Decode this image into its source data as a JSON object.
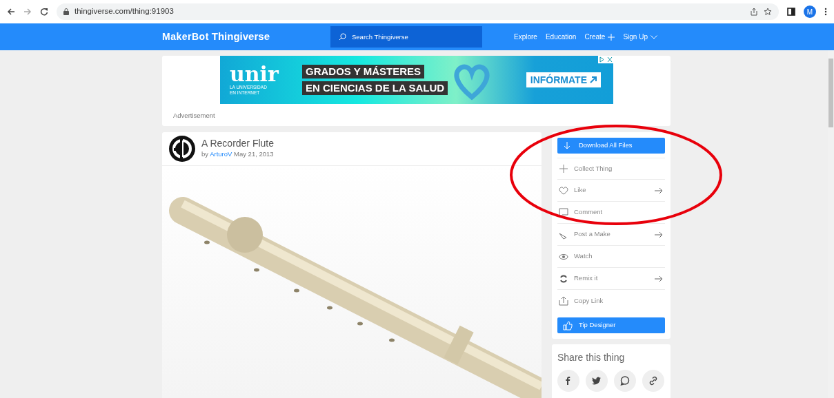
{
  "browser": {
    "url": "thingiverse.com/thing:91903",
    "profile_initial": "M"
  },
  "navbar": {
    "logo_brand": "MakerBot",
    "logo_name": "Thingiverse",
    "search_placeholder": "Search Thingiverse",
    "links": [
      {
        "label": "Explore",
        "kind": "plain"
      },
      {
        "label": "Education",
        "kind": "plain"
      },
      {
        "label": "Create",
        "kind": "plus"
      },
      {
        "label": "Sign Up",
        "kind": "dropdown"
      }
    ]
  },
  "ad": {
    "brand": "unir",
    "brand_lines": [
      "LA UNIVERSIDAD",
      "EN INTERNET"
    ],
    "headline": [
      "GRADOS Y MÁSTERES",
      "EN CIENCIAS DE LA SALUD"
    ],
    "cta": "INFÓRMATE",
    "label": "Advertisement"
  },
  "thing": {
    "title": "A Recorder Flute",
    "by": "by",
    "author": "ArturoV",
    "date": "May 21, 2013"
  },
  "actions": [
    {
      "kind": "primary",
      "label": "Download All Files",
      "arrow": false
    },
    {
      "kind": "item",
      "label": "Collect Thing",
      "arrow": false
    },
    {
      "kind": "item",
      "label": "Like",
      "arrow": true
    },
    {
      "kind": "item",
      "label": "Comment",
      "arrow": false
    },
    {
      "kind": "item",
      "label": "Post a Make",
      "arrow": true
    },
    {
      "kind": "item",
      "label": "Watch",
      "arrow": false
    },
    {
      "kind": "item",
      "label": "Remix it",
      "arrow": true
    },
    {
      "kind": "item",
      "label": "Copy Link",
      "arrow": false
    },
    {
      "kind": "primary",
      "label": "Tip Designer",
      "arrow": false
    }
  ],
  "share": {
    "title": "Share this thing"
  }
}
